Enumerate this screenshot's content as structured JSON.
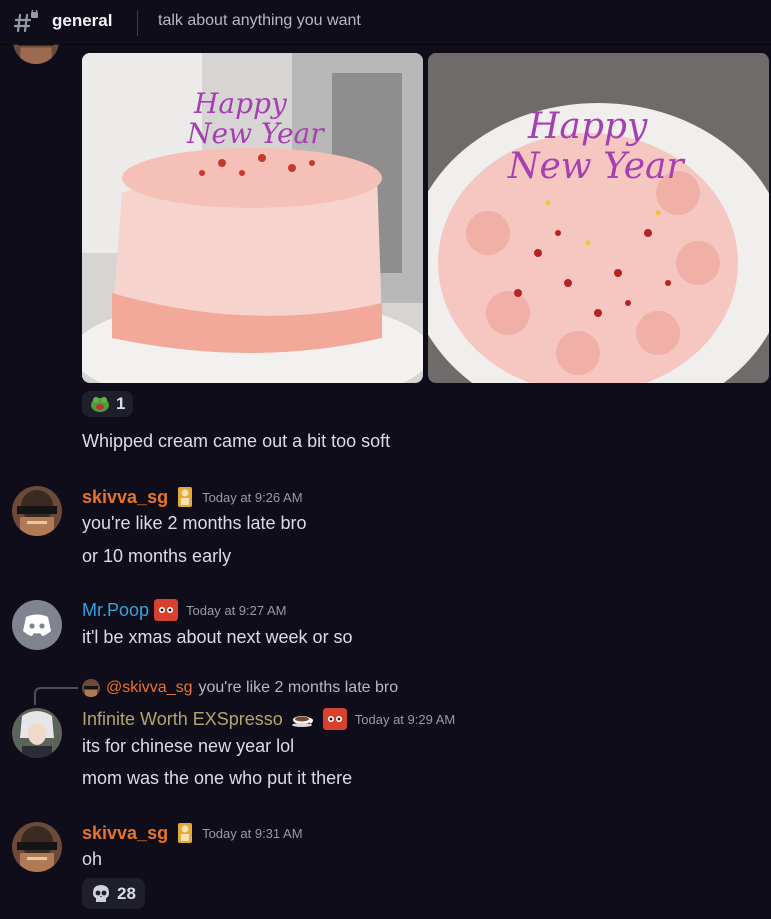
{
  "header": {
    "channel_name": "general",
    "topic": "talk about anything you want"
  },
  "attachment_message": {
    "images": [
      "cake-photo-side",
      "cake-photo-top"
    ],
    "cake_topper_text": "Happy New Year",
    "reaction_count": "1",
    "text": "Whipped cream came out a bit too soft"
  },
  "messages": [
    {
      "username": "skivva_sg",
      "username_color": "#e8732c",
      "timestamp": "Today at 9:26 AM",
      "lines": [
        "you're like 2 months late bro",
        "or 10 months early"
      ]
    },
    {
      "username": "Mr.Poop",
      "username_color": "#36a3e0",
      "timestamp": "Today at 9:27 AM",
      "lines": [
        "it'l be xmas about next week or so"
      ]
    },
    {
      "reply_to_user": "@skivva_sg",
      "reply_to_text": "you're like 2 months late bro",
      "username": "Infinite Worth EXSpresso",
      "username_color": "#b6a46c",
      "timestamp": "Today at 9:29 AM",
      "lines": [
        "its for chinese new year lol",
        "mom was the one who put it there"
      ]
    },
    {
      "username": "skivva_sg",
      "username_color": "#e8732c",
      "timestamp": "Today at 9:31 AM",
      "lines": [
        "oh"
      ],
      "reaction_count": "28"
    }
  ]
}
